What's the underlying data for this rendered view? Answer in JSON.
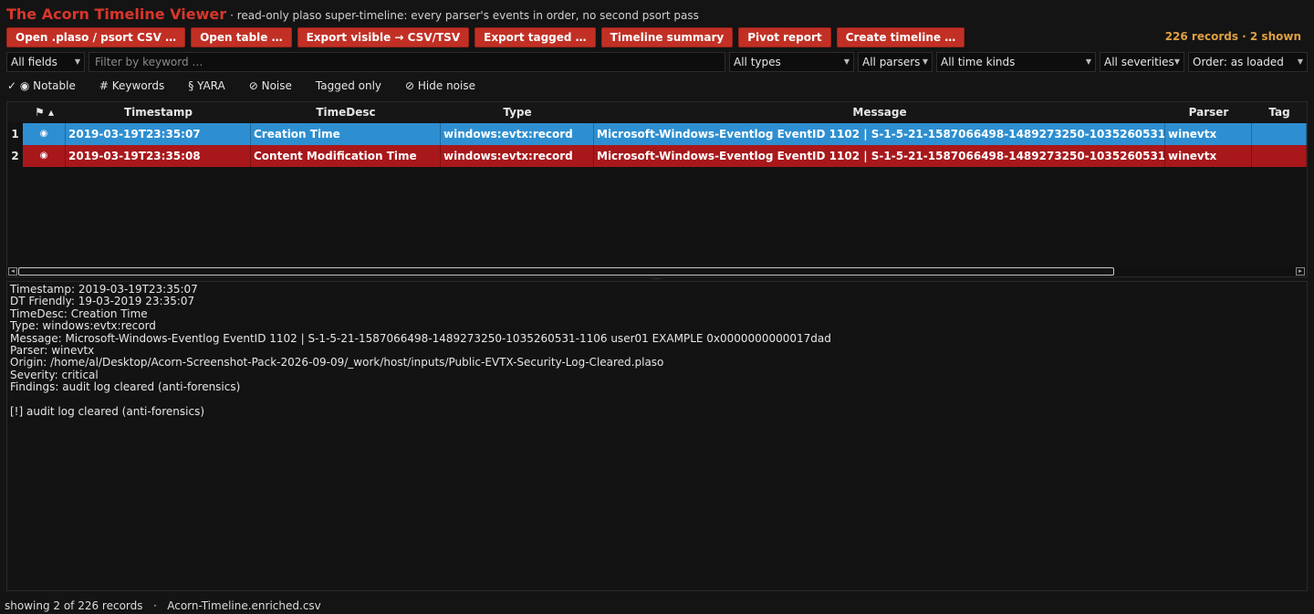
{
  "app": {
    "title": "The Acorn Timeline Viewer",
    "subtitle": "· read-only plaso super-timeline: every parser's events in order, no second psort pass"
  },
  "toolbar": {
    "open_plaso": "Open .plaso / psort CSV …",
    "open_table": "Open table …",
    "export_visible": "Export visible → CSV/TSV",
    "export_tagged": "Export tagged …",
    "timeline_summary": "Timeline summary",
    "pivot_report": "Pivot report",
    "create_timeline": "Create timeline …",
    "record_count": "226 records · 2 shown"
  },
  "filters": {
    "field": "All fields",
    "keyword_placeholder": "Filter by keyword …",
    "keyword_value": "",
    "types": "All types",
    "parsers": "All parsers",
    "time_kinds": "All time kinds",
    "severities": "All severities",
    "order": "Order: as loaded"
  },
  "toggles": {
    "notable": "✓ ◉ Notable",
    "keywords": "# Keywords",
    "yara": "§ YARA",
    "noise": "⊘ Noise",
    "tagged_only": "Tagged only",
    "hide_noise": "⊘ Hide noise"
  },
  "table": {
    "headers": {
      "flag": "⚑ ▴",
      "timestamp": "Timestamp",
      "timedesc": "TimeDesc",
      "type": "Type",
      "message": "Message",
      "parser": "Parser",
      "tag": "Tag"
    },
    "rows": [
      {
        "num": "1",
        "flag": "◉",
        "timestamp": "2019-03-19T23:35:07",
        "timedesc": "Creation Time",
        "type": "windows:evtx:record",
        "message": "Microsoft-Windows-Eventlog EventID 1102 | S-1-5-21-1587066498-1489273250-1035260531-1106 …",
        "parser": "winevtx",
        "tag": ""
      },
      {
        "num": "2",
        "flag": "◉",
        "timestamp": "2019-03-19T23:35:08",
        "timedesc": "Content Modification Time",
        "type": "windows:evtx:record",
        "message": "Microsoft-Windows-Eventlog EventID 1102 | S-1-5-21-1587066498-1489273250-1035260531-1106 …",
        "parser": "winevtx",
        "tag": ""
      }
    ],
    "colors": {
      "selected": "#2d8fd1",
      "critical": "#a8181b"
    }
  },
  "detail": {
    "lines": [
      "Timestamp: 2019-03-19T23:35:07",
      "DT Friendly: 19-03-2019 23:35:07",
      "TimeDesc: Creation Time",
      "Type: windows:evtx:record",
      "Message: Microsoft-Windows-Eventlog EventID 1102 | S-1-5-21-1587066498-1489273250-1035260531-1106 user01 EXAMPLE 0x0000000000017dad",
      "Parser: winevtx",
      "Origin: /home/al/Desktop/Acorn-Screenshot-Pack-2026-09-09/_work/host/inputs/Public-EVTX-Security-Log-Cleared.plaso",
      "Severity: critical",
      "Findings: audit log cleared (anti-forensics)",
      "",
      "[!] audit log cleared (anti-forensics)"
    ]
  },
  "status": {
    "text": "showing 2 of 226 records   ·   Acorn-Timeline.enriched.csv"
  },
  "theme": {
    "accent": "#c23025",
    "title": "#d9362c",
    "count": "#e0a040"
  }
}
